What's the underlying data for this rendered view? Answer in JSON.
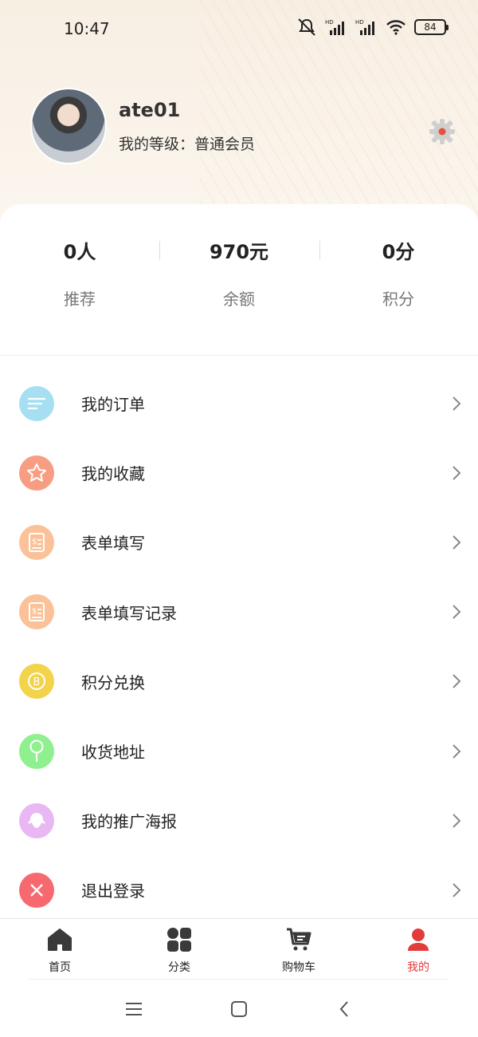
{
  "status_bar": {
    "time": "10:47",
    "battery": "84",
    "icons": [
      "mute-icon",
      "signal-hd-icon",
      "signal-hd-icon",
      "wifi-icon",
      "battery-icon"
    ]
  },
  "profile": {
    "username": "ate01",
    "level_label": "我的等级：",
    "level_value": "普通会员"
  },
  "stats": [
    {
      "value": "0人",
      "label": "推荐"
    },
    {
      "value": "970元",
      "label": "余额"
    },
    {
      "value": "0分",
      "label": "积分"
    }
  ],
  "menu": [
    {
      "label": "我的订单",
      "icon": "order-list-icon",
      "color": "#a6dff2"
    },
    {
      "label": "我的收藏",
      "icon": "star-icon",
      "color": "#f79e82"
    },
    {
      "label": "表单填写",
      "icon": "form-icon",
      "color": "#fbc29a"
    },
    {
      "label": "表单填写记录",
      "icon": "form-record-icon",
      "color": "#fbc29a"
    },
    {
      "label": "积分兑换",
      "icon": "coin-icon",
      "color": "#f2d34a"
    },
    {
      "label": "收货地址",
      "icon": "location-pin-icon",
      "color": "#8ff08f"
    },
    {
      "label": "我的推广海报",
      "icon": "poster-icon",
      "color": "#e9b7f4"
    },
    {
      "label": "退出登录",
      "icon": "close-icon",
      "color": "#f66a6f"
    }
  ],
  "tabs": [
    {
      "label": "首页",
      "icon": "home-icon",
      "active": false
    },
    {
      "label": "分类",
      "icon": "category-icon",
      "active": false
    },
    {
      "label": "购物车",
      "icon": "cart-icon",
      "active": false
    },
    {
      "label": "我的",
      "icon": "user-icon",
      "active": true
    }
  ],
  "colors": {
    "accent": "#e23b3b",
    "header_bg": "#f8efe3"
  }
}
